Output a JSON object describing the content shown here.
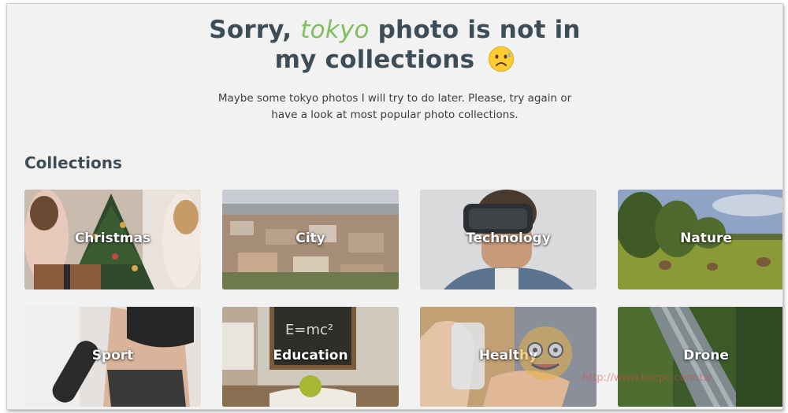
{
  "header": {
    "title_prefix": "Sorry,",
    "query": "tokyo",
    "title_suffix_line1": "photo is not in",
    "title_line2": "my collections",
    "emoji": "sad-face-with-sweat-icon",
    "message_line1": "Maybe some tokyo photos I will try to do later. Please, try again or",
    "message_line2": "have a look at most popular photo collections."
  },
  "collections": {
    "heading": "Collections",
    "items": [
      {
        "label": "Christmas",
        "icon": "christmas-photo"
      },
      {
        "label": "City",
        "icon": "city-photo"
      },
      {
        "label": "Technology",
        "icon": "technology-photo"
      },
      {
        "label": "Nature",
        "icon": "nature-photo"
      },
      {
        "label": "Sport",
        "icon": "sport-photo"
      },
      {
        "label": "Education",
        "icon": "education-photo"
      },
      {
        "label": "Healthy",
        "icon": "healthy-photo"
      },
      {
        "label": "Drone",
        "icon": "drone-photo"
      }
    ]
  },
  "watermark": {
    "url": "http://www.kocpc.com.tw"
  },
  "colors": {
    "heading": "#3d4d57",
    "query_accent": "#7fbf5c",
    "background": "#f2f2f2"
  }
}
